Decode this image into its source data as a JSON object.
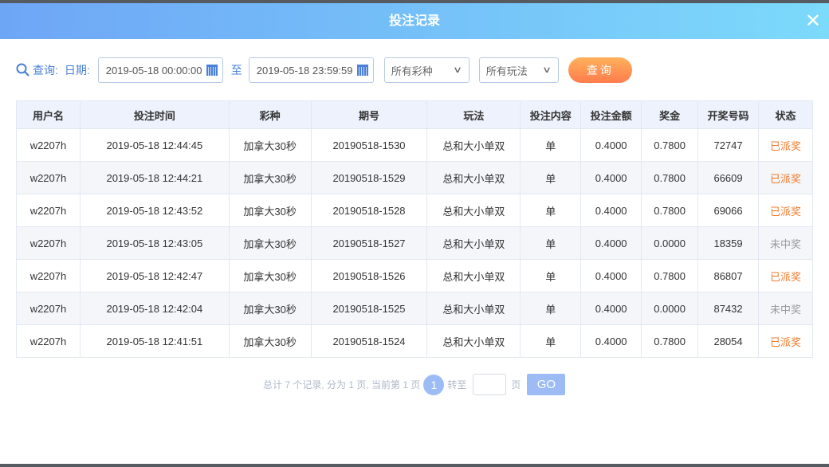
{
  "title": "投注记录",
  "filters": {
    "query_label": "查询:",
    "date_label": "日期:",
    "start": "2019-05-18 00:00:00",
    "to": "至",
    "end": "2019-05-18 23:59:59",
    "lottery": "所有彩种",
    "play": "所有玩法",
    "search_btn": "查询"
  },
  "table": {
    "headers": [
      "用户名",
      "投注时间",
      "彩种",
      "期号",
      "玩法",
      "投注内容",
      "投注金额",
      "奖金",
      "开奖号码",
      "状态"
    ],
    "rows": [
      [
        "w2207h",
        "2019-05-18 12:44:45",
        "加拿大30秒",
        "20190518-1530",
        "总和大小单双",
        "单",
        "0.4000",
        "0.7800",
        "72747",
        "已派奖"
      ],
      [
        "w2207h",
        "2019-05-18 12:44:21",
        "加拿大30秒",
        "20190518-1529",
        "总和大小单双",
        "单",
        "0.4000",
        "0.7800",
        "66609",
        "已派奖"
      ],
      [
        "w2207h",
        "2019-05-18 12:43:52",
        "加拿大30秒",
        "20190518-1528",
        "总和大小单双",
        "单",
        "0.4000",
        "0.7800",
        "69066",
        "已派奖"
      ],
      [
        "w2207h",
        "2019-05-18 12:43:05",
        "加拿大30秒",
        "20190518-1527",
        "总和大小单双",
        "单",
        "0.4000",
        "0.0000",
        "18359",
        "未中奖"
      ],
      [
        "w2207h",
        "2019-05-18 12:42:47",
        "加拿大30秒",
        "20190518-1526",
        "总和大小单双",
        "单",
        "0.4000",
        "0.7800",
        "86807",
        "已派奖"
      ],
      [
        "w2207h",
        "2019-05-18 12:42:04",
        "加拿大30秒",
        "20190518-1525",
        "总和大小单双",
        "单",
        "0.4000",
        "0.0000",
        "87432",
        "未中奖"
      ],
      [
        "w2207h",
        "2019-05-18 12:41:51",
        "加拿大30秒",
        "20190518-1524",
        "总和大小单双",
        "单",
        "0.4000",
        "0.7800",
        "28054",
        "已派奖"
      ]
    ]
  },
  "pager": {
    "summary": "总计 7 个记录, 分为 1 页, 当前第 1 页",
    "current": "1",
    "goto": "转至",
    "page": "页",
    "go": "GO"
  }
}
